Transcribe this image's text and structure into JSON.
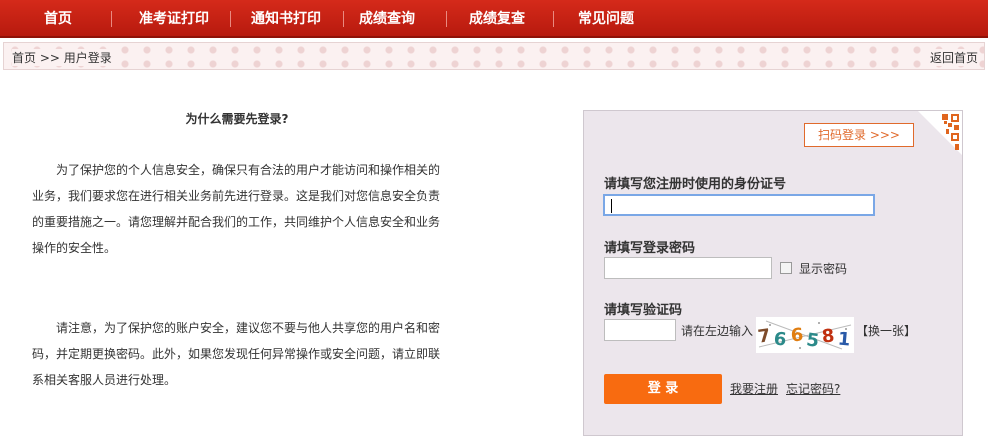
{
  "nav": {
    "items": [
      {
        "label": "首页"
      },
      {
        "label": "准考证打印"
      },
      {
        "label": "通知书打印"
      },
      {
        "label": "成绩查询"
      },
      {
        "label": "成绩复查"
      },
      {
        "label": "常见问题"
      }
    ]
  },
  "breadcrumb": {
    "path": "首页 >> 用户登录",
    "back_label": "返回首页"
  },
  "info": {
    "title": "为什么需要先登录?",
    "paragraph1": "为了保护您的个人信息安全，确保只有合法的用户才能访问和操作相关的业务，我们要求您在进行相关业务前先进行登录。这是我们对您信息安全负责的重要措施之一。请您理解并配合我们的工作，共同维护个人信息安全和业务操作的安全性。",
    "paragraph2": "请注意，为了保护您的账户安全，建议您不要与他人共享您的用户名和密码，并定期更换密码。此外，如果您发现任何异常操作或安全问题，请立即联系相关客服人员进行处理。"
  },
  "login": {
    "scan_label": "扫码登录 >>>",
    "id_label": "请填写您注册时使用的身份证号",
    "id_value": "",
    "password_label": "请填写登录密码",
    "password_value": "",
    "show_password_label": "显示密码",
    "show_password_checked": false,
    "captcha_label": "请填写验证码",
    "captcha_value": "",
    "captcha_hint": "请在左边输入",
    "captcha_text": "766581",
    "captcha_change": "【换一张】",
    "login_button": "登 录",
    "register_link": "我要注册",
    "forgot_link": "忘记密码?"
  },
  "colors": {
    "nav_red": "#c72215",
    "accent_orange": "#f86b10",
    "panel_bg": "#ece6ec"
  }
}
